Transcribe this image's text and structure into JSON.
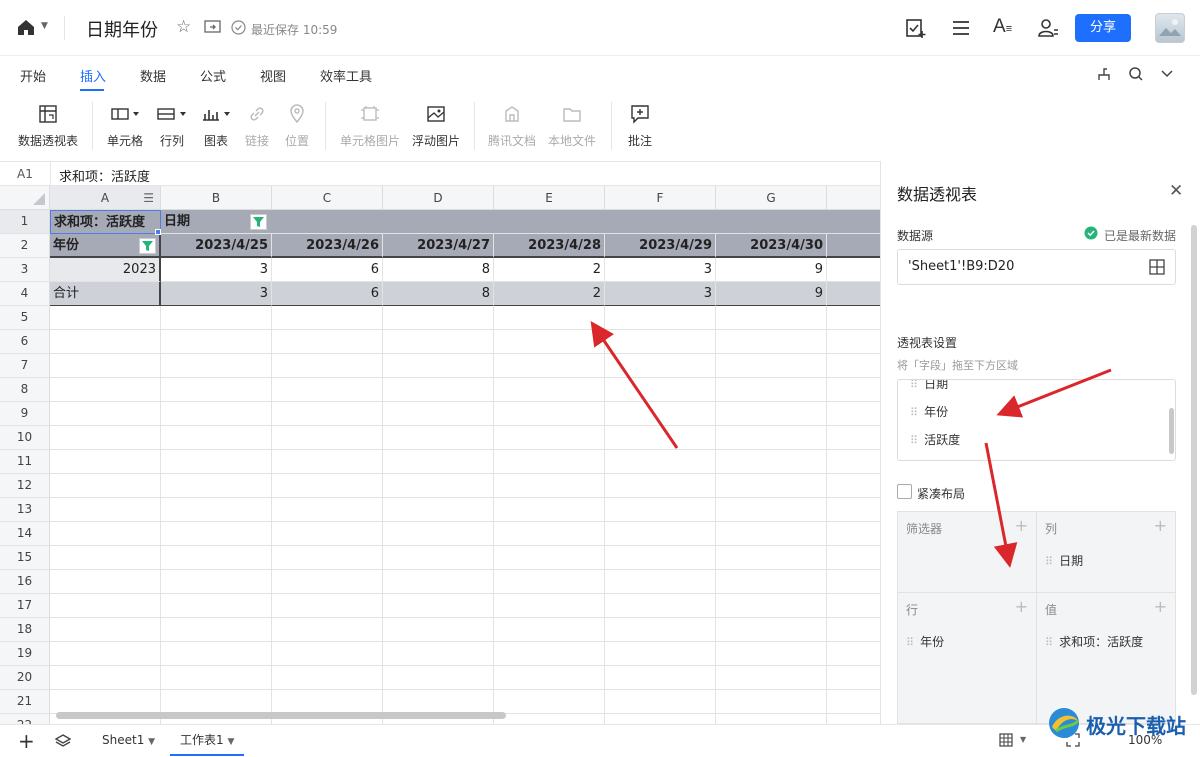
{
  "topbar": {
    "title": "日期年份",
    "save_status": "最近保存 10:59",
    "share_label": "分享"
  },
  "menu": {
    "tabs": [
      "开始",
      "插入",
      "数据",
      "公式",
      "视图",
      "效率工具"
    ],
    "active_tab": "插入"
  },
  "toolbar": {
    "pivot": "数据透视表",
    "cell": "单元格",
    "rowcol": "行列",
    "chart": "图表",
    "link": "链接",
    "location": "位置",
    "cell_image": "单元格图片",
    "float_image": "浮动图片",
    "tencent_doc": "腾讯文档",
    "local_file": "本地文件",
    "comment": "批注"
  },
  "formula_bar": {
    "cell_ref": "A1",
    "content": "求和项：活跃度"
  },
  "grid": {
    "columns": [
      "A",
      "B",
      "C",
      "D",
      "E",
      "F",
      "G"
    ],
    "rows": [
      "1",
      "2",
      "3",
      "4",
      "5",
      "6",
      "7",
      "8",
      "9",
      "10",
      "11",
      "12",
      "13",
      "14",
      "15",
      "16",
      "17",
      "18",
      "19",
      "20",
      "21",
      "22"
    ],
    "pivot": {
      "corner": "求和项：活跃度",
      "col_field": "日期",
      "row_field": "年份",
      "dates": [
        "2023/4/25",
        "2023/4/26",
        "2023/4/27",
        "2023/4/28",
        "2023/4/29",
        "2023/4/30"
      ],
      "year": "2023",
      "values": [
        "3",
        "6",
        "8",
        "2",
        "3",
        "9"
      ],
      "total_label": "合计",
      "totals": [
        "3",
        "6",
        "8",
        "2",
        "3",
        "9"
      ]
    }
  },
  "panel": {
    "title": "数据透视表",
    "source_label": "数据源",
    "status": "已是最新数据",
    "source_value": "'Sheet1'!B9:D20",
    "settings_label": "透视表设置",
    "hint": "将「字段」拖至下方区域",
    "fields": [
      "日期",
      "年份",
      "活跃度"
    ],
    "compact_label": "紧凑布局",
    "zones": {
      "filter": "筛选器",
      "column": "列",
      "column_item": "日期",
      "row": "行",
      "row_item": "年份",
      "value": "值",
      "value_item": "求和项：活跃度"
    }
  },
  "bottom": {
    "sheets": [
      "Sheet1",
      "工作表1"
    ],
    "active_sheet": "工作表1",
    "zoom": "100%",
    "watermark": "极光下载站"
  },
  "colors": {
    "accent": "#1f6fff",
    "pivot_header": "#a6a9b6",
    "pivot_total": "#cfd1d9",
    "arrow": "#d9272c"
  }
}
